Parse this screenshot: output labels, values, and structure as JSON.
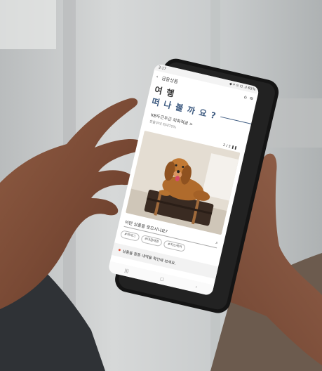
{
  "status_bar": {
    "time": "3:17",
    "right": "◆ ▾ ⊙ ⊡ .ıl 65%"
  },
  "top_bar": {
    "back_icon": "chevron-left-icon",
    "title": "금융상품",
    "home_icon": "home-icon",
    "menu_icon": "menu-icon"
  },
  "hero": {
    "line1": "여 행",
    "line2": "떠 나 볼 까 요 ?"
  },
  "product": {
    "name": "KB두근두근 외화적금 >",
    "rate": "한율우대 최대70%",
    "pager": "2 / 3  ❚❚"
  },
  "search": {
    "question": "어떤 상품을 찾으시나요?",
    "icon": "search-icon"
  },
  "tags": [
    "#외대그",
    "#대접대면",
    "#지드렉어"
  ],
  "notice": {
    "text": "상품을 활동 내역을 확인해 보세요."
  },
  "nav": {
    "recent": "|||",
    "home": "▢",
    "back": "‹"
  },
  "colors": {
    "accent_blue": "#3d5a80",
    "dot_red": "#e2533b"
  }
}
